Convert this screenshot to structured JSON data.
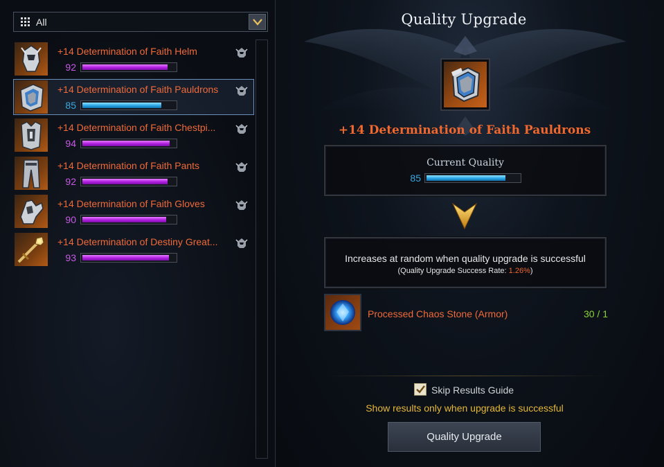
{
  "filter": {
    "label": "All"
  },
  "items": [
    {
      "name": "+14 Determination of Faith Helm",
      "quality": "92",
      "quality_level": 0.92,
      "tier": "purple",
      "icon": "helm-icon"
    },
    {
      "name": "+14 Determination of Faith Pauldrons",
      "quality": "85",
      "quality_level": 0.85,
      "tier": "blue",
      "icon": "pauldrons-icon",
      "selected": true
    },
    {
      "name": "+14 Determination of Faith Chestpi...",
      "quality": "94",
      "quality_level": 0.94,
      "tier": "purple",
      "icon": "chestpiece-icon"
    },
    {
      "name": "+14 Determination of Faith Pants",
      "quality": "92",
      "quality_level": 0.92,
      "tier": "purple",
      "icon": "pants-icon"
    },
    {
      "name": "+14 Determination of Faith Gloves",
      "quality": "90",
      "quality_level": 0.9,
      "tier": "purple",
      "icon": "gloves-icon"
    },
    {
      "name": "+14 Determination of Destiny Great...",
      "quality": "93",
      "quality_level": 0.93,
      "tier": "purple",
      "icon": "weapon-icon"
    }
  ],
  "panel": {
    "title": "Quality Upgrade",
    "selected_item_name": "+14 Determination of Faith Pauldrons",
    "current_quality_label": "Current Quality",
    "current_quality": "85",
    "current_quality_level": 0.85,
    "info_line": "Increases at random when quality upgrade is successful",
    "rate_prefix": "(Quality Upgrade Success Rate: ",
    "success_rate": "1.26%",
    "rate_suffix": ")",
    "material_name": "Processed Chaos Stone (Armor)",
    "material_count": "30 / 1",
    "skip_label": "Skip Results Guide",
    "skip_checked": true,
    "skip_note": "Show results only when upgrade is successful",
    "upgrade_button": "Quality Upgrade"
  },
  "colors": {
    "item_name": "#f06a3a",
    "quality_purple": "#c85ae6",
    "quality_blue": "#39a9e0",
    "material_count": "#8bd13a",
    "note": "#e6b83a"
  }
}
